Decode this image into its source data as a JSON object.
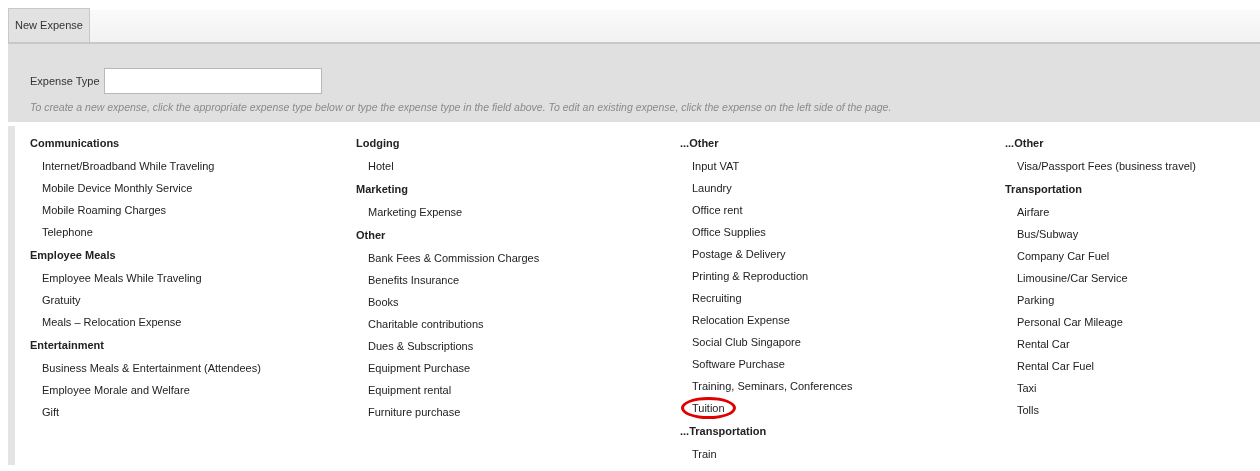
{
  "tabs": [
    {
      "label": "New Expense",
      "selected": true
    }
  ],
  "expense_type": {
    "label": "Expense Type"
  },
  "hint": "To create a new expense, click the appropriate expense type below or type the expense type in the field above. To edit an existing expense, click the expense on the left side of the page.",
  "columns": [
    [
      {
        "heading": "Communications",
        "items": [
          {
            "label": "Internet/Broadband While Traveling",
            "circled": false
          },
          {
            "label": "Mobile Device Monthly Service",
            "circled": false
          },
          {
            "label": "Mobile Roaming Charges",
            "circled": false
          },
          {
            "label": "Telephone",
            "circled": false
          }
        ]
      },
      {
        "heading": "Employee Meals",
        "items": [
          {
            "label": "Employee Meals While Traveling",
            "circled": false
          },
          {
            "label": "Gratuity",
            "circled": false
          },
          {
            "label": "Meals – Relocation Expense",
            "circled": false
          }
        ]
      },
      {
        "heading": "Entertainment",
        "items": [
          {
            "label": "Business Meals & Entertainment (Attendees)",
            "circled": false
          },
          {
            "label": "Employee Morale and Welfare",
            "circled": false
          },
          {
            "label": "Gift",
            "circled": false
          }
        ]
      }
    ],
    [
      {
        "heading": "Lodging",
        "items": [
          {
            "label": "Hotel",
            "circled": false
          }
        ]
      },
      {
        "heading": "Marketing",
        "items": [
          {
            "label": "Marketing Expense",
            "circled": false
          }
        ]
      },
      {
        "heading": "Other",
        "items": [
          {
            "label": "Bank Fees & Commission Charges",
            "circled": false
          },
          {
            "label": "Benefits Insurance",
            "circled": false
          },
          {
            "label": "Books",
            "circled": false
          },
          {
            "label": "Charitable contributions",
            "circled": false
          },
          {
            "label": "Dues & Subscriptions",
            "circled": false
          },
          {
            "label": "Equipment Purchase",
            "circled": false
          },
          {
            "label": "Equipment rental",
            "circled": false
          },
          {
            "label": "Furniture purchase",
            "circled": false
          }
        ]
      }
    ],
    [
      {
        "heading": "...Other",
        "items": [
          {
            "label": "Input VAT",
            "circled": false
          },
          {
            "label": "Laundry",
            "circled": false
          },
          {
            "label": "Office rent",
            "circled": false
          },
          {
            "label": "Office Supplies",
            "circled": false
          },
          {
            "label": "Postage & Delivery",
            "circled": false
          },
          {
            "label": "Printing & Reproduction",
            "circled": false
          },
          {
            "label": "Recruiting",
            "circled": false
          },
          {
            "label": "Relocation Expense",
            "circled": false
          },
          {
            "label": "Social Club Singapore",
            "circled": false
          },
          {
            "label": "Software Purchase",
            "circled": false
          },
          {
            "label": "Training, Seminars, Conferences",
            "circled": false
          },
          {
            "label": "Tuition",
            "circled": true
          }
        ]
      },
      {
        "heading": "...Transportation",
        "items": [
          {
            "label": "Train",
            "circled": false
          }
        ]
      }
    ],
    [
      {
        "heading": "...Other",
        "items": [
          {
            "label": "Visa/Passport Fees (business travel)",
            "circled": false
          }
        ]
      },
      {
        "heading": "Transportation",
        "items": [
          {
            "label": "Airfare",
            "circled": false
          },
          {
            "label": "Bus/Subway",
            "circled": false
          },
          {
            "label": "Company Car Fuel",
            "circled": false
          },
          {
            "label": "Limousine/Car Service",
            "circled": false
          },
          {
            "label": "Parking",
            "circled": false
          },
          {
            "label": "Personal Car Mileage",
            "circled": false
          },
          {
            "label": "Rental Car",
            "circled": false
          },
          {
            "label": "Rental Car Fuel",
            "circled": false
          },
          {
            "label": "Taxi",
            "circled": false
          },
          {
            "label": "Tolls",
            "circled": false
          }
        ]
      }
    ]
  ]
}
